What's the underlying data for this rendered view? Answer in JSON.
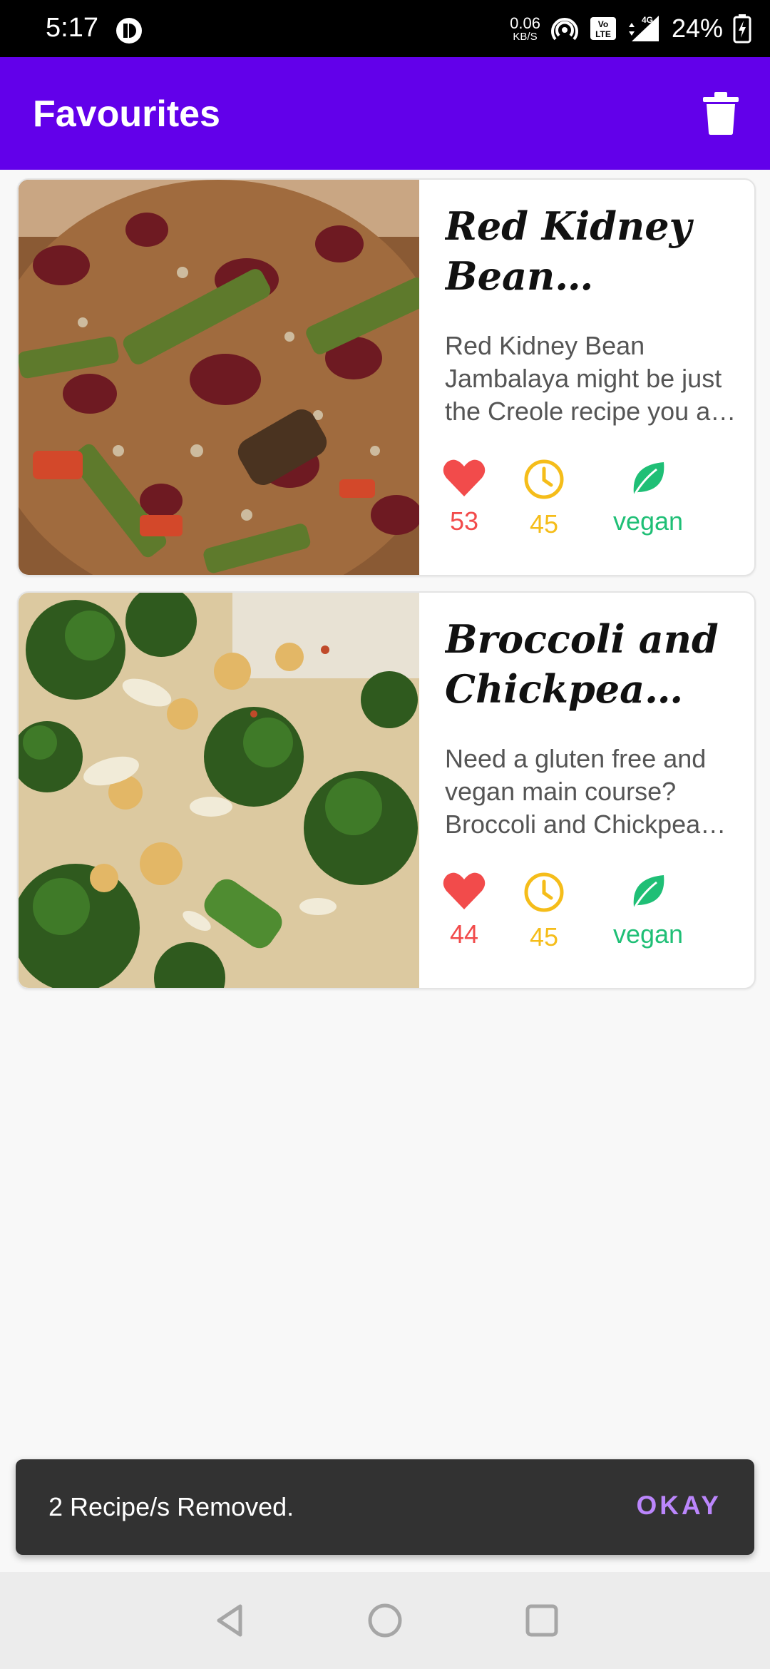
{
  "status_bar": {
    "time": "5:17",
    "net_speed_value": "0.06",
    "net_speed_unit": "KB/S",
    "battery_percent": "24%",
    "icons": [
      "app-notification-icon",
      "hotspot-icon",
      "volte-icon",
      "signal-4g-icon",
      "battery-icon"
    ]
  },
  "app_bar": {
    "title": "Favourites",
    "action_icon": "trash-icon"
  },
  "recipes": [
    {
      "title": "Red Kidney Bean Jambalaya",
      "description": "Red Kidney Bean Jambalaya might be just the Creole recipe you are searching for.",
      "likes": "53",
      "minutes": "45",
      "diet": "vegan"
    },
    {
      "title": "Broccoli and Chickpea Rice Salad",
      "description": "Need a gluten free and vegan main course? Broccoli and Chickpea Rice Salad could be an amazing recipe to try.",
      "likes": "44",
      "minutes": "45",
      "diet": "vegan"
    }
  ],
  "snackbar": {
    "message": "2 Recipe/s Removed.",
    "action": "OKAY"
  },
  "colors": {
    "app_bar": "#6200ea",
    "likes": "#f24b4b",
    "time": "#f5bd1a",
    "vegan": "#1fbf76",
    "snackbar_action": "#bb86fc"
  },
  "nav_bar": {
    "buttons": [
      "back-icon",
      "home-icon",
      "recents-icon"
    ]
  }
}
